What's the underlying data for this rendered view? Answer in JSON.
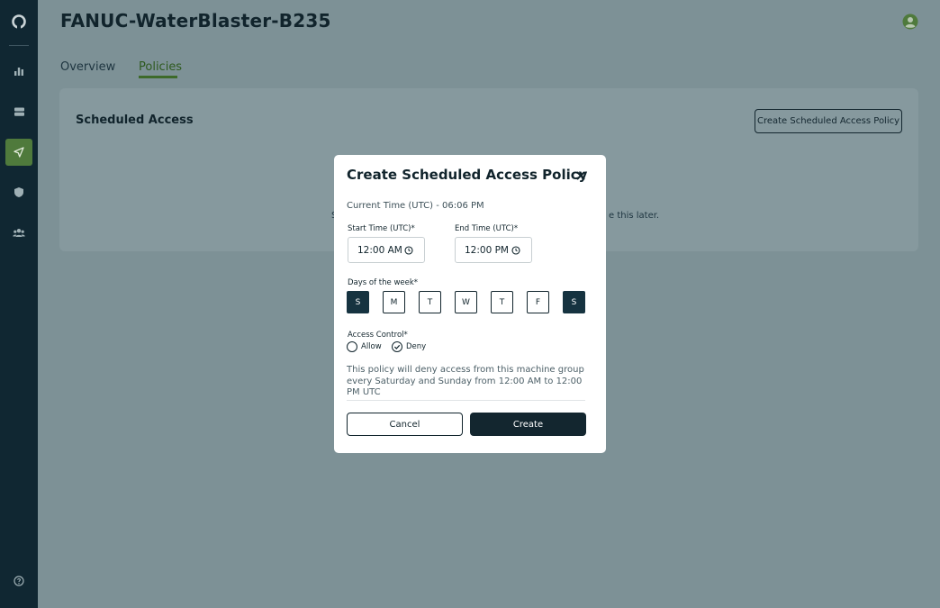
{
  "page": {
    "title": "FANUC-WaterBlaster-B235"
  },
  "sidebar": {
    "items": [
      {
        "icon": "logo-ring-icon"
      },
      {
        "icon": "bar-chart-icon"
      },
      {
        "icon": "server-icon"
      },
      {
        "icon": "send-icon",
        "active": true
      },
      {
        "icon": "shield-icon"
      },
      {
        "icon": "users-icon"
      },
      {
        "icon": "help-icon"
      }
    ]
  },
  "tabs": [
    {
      "label": "Overview"
    },
    {
      "label": "Policies",
      "active": true
    }
  ],
  "card": {
    "title": "Scheduled Access",
    "button_label": "Create Scheduled Access Policy",
    "partial_left": "S",
    "partial_right": "e this later."
  },
  "modal": {
    "title": "Create Scheduled Access Policy",
    "current_time": "Current Time (UTC) - 06:06 PM",
    "start_label": "Start Time (UTC)*",
    "start_value": "12:00 AM",
    "end_label": "End Time (UTC)*",
    "end_value": "12:00 PM",
    "days_label": "Days of the week*",
    "days": [
      {
        "label": "S",
        "selected": true
      },
      {
        "label": "M",
        "selected": false
      },
      {
        "label": "T",
        "selected": false
      },
      {
        "label": "W",
        "selected": false
      },
      {
        "label": "T",
        "selected": false
      },
      {
        "label": "F",
        "selected": false
      },
      {
        "label": "S",
        "selected": true
      }
    ],
    "access_label": "Access Control*",
    "access_options": [
      {
        "label": "Allow",
        "selected": false
      },
      {
        "label": "Deny",
        "selected": true
      }
    ],
    "description": "This policy will deny access from this machine group every Saturday and Sunday from 12:00 AM to 12:00 PM UTC",
    "cancel_label": "Cancel",
    "create_label": "Create"
  },
  "colors": {
    "sidebar_bg": "#102732",
    "accent_green": "#4f7a3c",
    "primary_dark": "#13262f",
    "overlay": "#7d9196"
  }
}
